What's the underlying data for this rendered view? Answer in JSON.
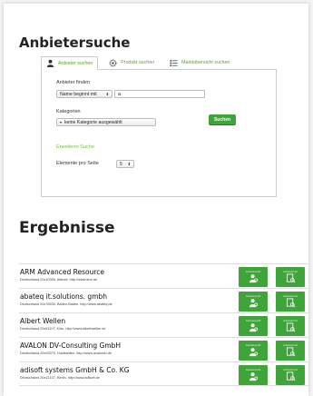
{
  "page": {
    "title": "Anbietersuche"
  },
  "tabs": [
    {
      "label": "Anbieter suchen",
      "icon": "person-icon",
      "active": true
    },
    {
      "label": "Produkt suchen",
      "icon": "gear-icon",
      "active": false
    },
    {
      "label": "Marktübersicht suchen",
      "icon": "list-icon",
      "active": false
    }
  ],
  "search": {
    "find_label": "Anbieter finden",
    "match_mode": "Name beginnt mit",
    "query_value": "a",
    "category_label": "Kategorien",
    "category_value": "keine Kategorie ausgewählt",
    "advanced_link": "Erweiterte Suche",
    "per_page_label": "Elemente pro Seite",
    "per_page_value": "5",
    "submit_label": "Suchen"
  },
  "results": {
    "title": "Ergebnisse",
    "button_caption_1": "Anbieterprofil",
    "button_caption_2": "Anbieterbrief",
    "items": [
      {
        "name": "ARM Advanced Resource",
        "detail": "Deutschland 20x10355, Alterstr. http://www.arm.de"
      },
      {
        "name": "abateq it.solutions. gmbh",
        "detail": "Deutschland 20x76530, Baden-Baden. http://www.abateq.de"
      },
      {
        "name": "Albert Wellen",
        "detail": "Deutschland 20x51107, Köln. http://www.albertwellen.de"
      },
      {
        "name": "AVALON DV-Consulting GmbH",
        "detail": "Deutschland 20x03370, Huststetten. http://www.avalondv.de"
      },
      {
        "name": "adisoft systems GmbH & Co. KG",
        "detail": "Deutschland 20x12107, Berlin. http://www.adisoft.de"
      }
    ]
  },
  "colors": {
    "accent": "#3fa43a",
    "link": "#7bbf4a"
  }
}
